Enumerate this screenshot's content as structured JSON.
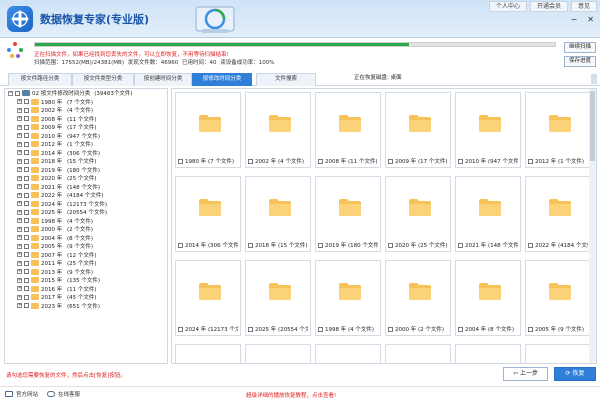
{
  "header": {
    "title": "数据恢复专家(专业版)",
    "links": [
      "个人中心",
      "开通会员",
      "意见"
    ],
    "controls": [
      "−",
      "✕"
    ]
  },
  "status": {
    "warning": "正在扫描文件，如果已经找到您丢失的文件，可以立即恢复，不用等待扫描结束!",
    "stats": "扫描范围：17552(MB)/24381(MB)   发现文件数：46960   已用时间：40   读设备成功率：100%",
    "progress": 0.72,
    "progress_color": "#2aa84a",
    "stop_button": "继续扫描",
    "save_button": "保存进度"
  },
  "tabs": {
    "items": [
      "按文件路径分类",
      "按文件类型分类",
      "按创建时间分类",
      "按修改时间分类",
      "文件搜索"
    ],
    "active_index": 3,
    "restore_location": "正在恢复磁盘: 桌面",
    "accent": "#2f7fd9"
  },
  "tree": {
    "root_label": "02 按文件修改时间分类",
    "root_count": "(39483个文件)",
    "items": [
      {
        "year": "1980 年",
        "count": "(7 个文件)"
      },
      {
        "year": "2002 年",
        "count": "(4 个文件)"
      },
      {
        "year": "2008 年",
        "count": "(11 个文件)"
      },
      {
        "year": "2009 年",
        "count": "(17 个文件)"
      },
      {
        "year": "2010 年",
        "count": "(947 个文件)"
      },
      {
        "year": "2012 年",
        "count": "(1 个文件)"
      },
      {
        "year": "2014 年",
        "count": "(306 个文件)"
      },
      {
        "year": "2018 年",
        "count": "(15 个文件)"
      },
      {
        "year": "2019 年",
        "count": "(180 个文件)"
      },
      {
        "year": "2020 年",
        "count": "(25 个文件)"
      },
      {
        "year": "2021 年",
        "count": "(148 个文件)"
      },
      {
        "year": "2022 年",
        "count": "(4184 个文件)"
      },
      {
        "year": "2024 年",
        "count": "(12173 个文件)"
      },
      {
        "year": "2025 年",
        "count": "(20554 个文件)"
      },
      {
        "year": "1998 年",
        "count": "(4 个文件)"
      },
      {
        "year": "2000 年",
        "count": "(2 个文件)"
      },
      {
        "year": "2004 年",
        "count": "(8 个文件)"
      },
      {
        "year": "2005 年",
        "count": "(9 个文件)"
      },
      {
        "year": "2007 年",
        "count": "(12 个文件)"
      },
      {
        "year": "2011 年",
        "count": "(25 个文件)"
      },
      {
        "year": "2013 年",
        "count": "(9 个文件)"
      },
      {
        "year": "2015 年",
        "count": "(135 个文件)"
      },
      {
        "year": "2016 年",
        "count": "(11 个文件)"
      },
      {
        "year": "2017 年",
        "count": "(45 个文件)"
      },
      {
        "year": "2023 年",
        "count": "(651 个文件)"
      }
    ]
  },
  "grid": {
    "folder_color": "#f6c25a",
    "items": [
      "1980 年 (7 个文件)",
      "2002 年 (4 个文件)",
      "2008 年 (11 个文件)",
      "2009 年 (17 个文件)",
      "2010 年 (947 个文件)",
      "2012 年 (1 个文件)",
      "2014 年 (306 个文件)",
      "2018 年 (15 个文件)",
      "2019 年 (180 个文件)",
      "2020 年 (25 个文件)",
      "2021 年 (148 个文件)",
      "2022 年 (4184 个文件)",
      "2024 年 (12173 个文件)",
      "2025 年 (20554 个文件)",
      "1998 年 (4 个文件)",
      "2000 年 (2 个文件)",
      "2004 年 (8 个文件)",
      "2005 年 (9 个文件)",
      "",
      "",
      "",
      "",
      "",
      ""
    ]
  },
  "bottom": {
    "hint": "请勾选您需要恢复的文件，然后点击[恢复]按钮。",
    "prev_button": "上一步",
    "recover_button": "恢复"
  },
  "footer": {
    "website": "官方网站",
    "service": "在线客服",
    "tutorial": "超级详细的播放恢复教程，点击查看!"
  }
}
